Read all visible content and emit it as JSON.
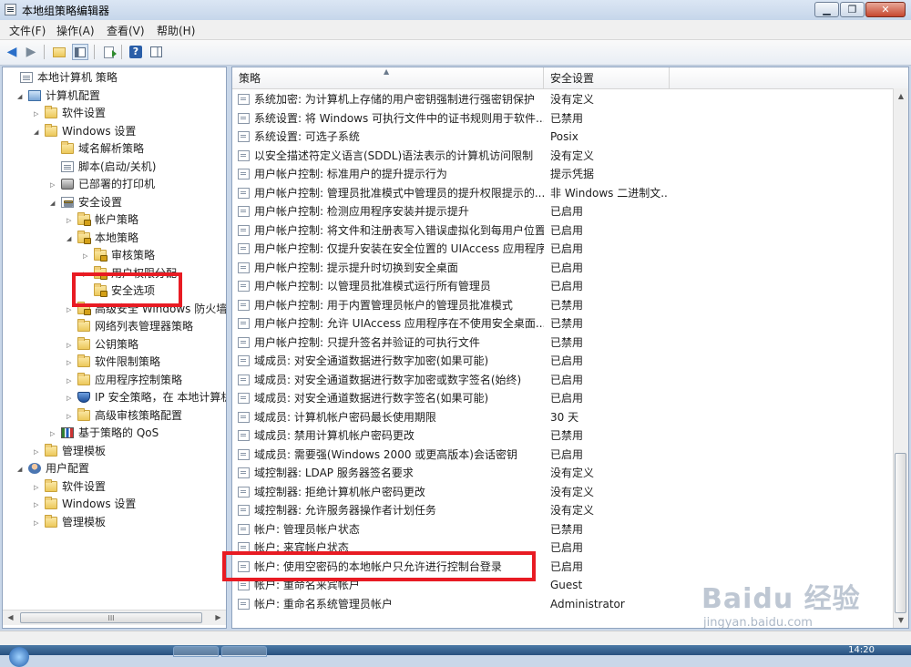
{
  "window": {
    "title": "本地组策略编辑器",
    "buttons": [
      "▁",
      "❐",
      "✕"
    ]
  },
  "menubar": [
    "文件(F)",
    "操作(A)",
    "查看(V)",
    "帮助(H)"
  ],
  "tree": [
    {
      "label": "本地计算机 策略",
      "indent": 0,
      "toggle": "",
      "icon": "doc"
    },
    {
      "label": "计算机配置",
      "indent": 1,
      "toggle": "◢",
      "icon": "comp"
    },
    {
      "label": "软件设置",
      "indent": 2,
      "toggle": "▷",
      "icon": "folder"
    },
    {
      "label": "Windows 设置",
      "indent": 2,
      "toggle": "◢",
      "icon": "folder"
    },
    {
      "label": "域名解析策略",
      "indent": 3,
      "toggle": "",
      "icon": "folder"
    },
    {
      "label": "脚本(启动/关机)",
      "indent": 3,
      "toggle": "",
      "icon": "doc"
    },
    {
      "label": "已部署的打印机",
      "indent": 3,
      "toggle": "▷",
      "icon": "printer"
    },
    {
      "label": "安全设置",
      "indent": 3,
      "toggle": "◢",
      "icon": "lock"
    },
    {
      "label": "帐户策略",
      "indent": 4,
      "toggle": "▷",
      "icon": "folderlock"
    },
    {
      "label": "本地策略",
      "indent": 4,
      "toggle": "◢",
      "icon": "folderlock"
    },
    {
      "label": "审核策略",
      "indent": 5,
      "toggle": "▷",
      "icon": "folderlock"
    },
    {
      "label": "用户权限分配",
      "indent": 5,
      "toggle": "▷",
      "icon": "folderlock"
    },
    {
      "label": "安全选项",
      "indent": 5,
      "toggle": "",
      "icon": "folderlock"
    },
    {
      "label": "高级安全 Windows 防火墙",
      "indent": 4,
      "toggle": "▷",
      "icon": "folderlock"
    },
    {
      "label": "网络列表管理器策略",
      "indent": 4,
      "toggle": "",
      "icon": "folder"
    },
    {
      "label": "公钥策略",
      "indent": 4,
      "toggle": "▷",
      "icon": "folder"
    },
    {
      "label": "软件限制策略",
      "indent": 4,
      "toggle": "▷",
      "icon": "folder"
    },
    {
      "label": "应用程序控制策略",
      "indent": 4,
      "toggle": "▷",
      "icon": "folder"
    },
    {
      "label": "IP 安全策略，在 本地计算机",
      "indent": 4,
      "toggle": "▷",
      "icon": "shield"
    },
    {
      "label": "高级审核策略配置",
      "indent": 4,
      "toggle": "▷",
      "icon": "folder"
    },
    {
      "label": "基于策略的 QoS",
      "indent": 3,
      "toggle": "▷",
      "icon": "chart"
    },
    {
      "label": "管理模板",
      "indent": 2,
      "toggle": "▷",
      "icon": "folder"
    },
    {
      "label": "用户配置",
      "indent": 1,
      "toggle": "◢",
      "icon": "user"
    },
    {
      "label": "软件设置",
      "indent": 2,
      "toggle": "▷",
      "icon": "folder"
    },
    {
      "label": "Windows 设置",
      "indent": 2,
      "toggle": "▷",
      "icon": "folder"
    },
    {
      "label": "管理模板",
      "indent": 2,
      "toggle": "▷",
      "icon": "folder"
    }
  ],
  "left_scroll": {
    "left": "◀",
    "right": "▶",
    "grip": "III"
  },
  "columns": {
    "policy": "策略",
    "setting": "安全设置",
    "sort": "▲"
  },
  "policies": [
    {
      "name": "系统加密: 为计算机上存储的用户密钥强制进行强密钥保护",
      "setting": "没有定义"
    },
    {
      "name": "系统设置: 将 Windows 可执行文件中的证书规则用于软件...",
      "setting": "已禁用"
    },
    {
      "name": "系统设置: 可选子系统",
      "setting": "Posix"
    },
    {
      "name": "以安全描述符定义语言(SDDL)语法表示的计算机访问限制",
      "setting": "没有定义"
    },
    {
      "name": "用户帐户控制: 标准用户的提升提示行为",
      "setting": "提示凭据"
    },
    {
      "name": "用户帐户控制: 管理员批准模式中管理员的提升权限提示的...",
      "setting": "非 Windows 二进制文..."
    },
    {
      "name": "用户帐户控制: 检测应用程序安装并提示提升",
      "setting": "已启用"
    },
    {
      "name": "用户帐户控制: 将文件和注册表写入错误虚拟化到每用户位置",
      "setting": "已启用"
    },
    {
      "name": "用户帐户控制: 仅提升安装在安全位置的 UIAccess 应用程序",
      "setting": "已启用"
    },
    {
      "name": "用户帐户控制: 提示提升时切换到安全桌面",
      "setting": "已启用"
    },
    {
      "name": "用户帐户控制: 以管理员批准模式运行所有管理员",
      "setting": "已启用"
    },
    {
      "name": "用户帐户控制: 用于内置管理员帐户的管理员批准模式",
      "setting": "已禁用"
    },
    {
      "name": "用户帐户控制: 允许 UIAccess 应用程序在不使用安全桌面...",
      "setting": "已禁用"
    },
    {
      "name": "用户帐户控制: 只提升签名并验证的可执行文件",
      "setting": "已禁用"
    },
    {
      "name": "域成员: 对安全通道数据进行数字加密(如果可能)",
      "setting": "已启用"
    },
    {
      "name": "域成员: 对安全通道数据进行数字加密或数字签名(始终)",
      "setting": "已启用"
    },
    {
      "name": "域成员: 对安全通道数据进行数字签名(如果可能)",
      "setting": "已启用"
    },
    {
      "name": "域成员: 计算机帐户密码最长使用期限",
      "setting": "30 天"
    },
    {
      "name": "域成员: 禁用计算机帐户密码更改",
      "setting": "已禁用"
    },
    {
      "name": "域成员: 需要强(Windows 2000 或更高版本)会话密钥",
      "setting": "已启用"
    },
    {
      "name": "域控制器: LDAP 服务器签名要求",
      "setting": "没有定义"
    },
    {
      "name": "域控制器: 拒绝计算机帐户密码更改",
      "setting": "没有定义"
    },
    {
      "name": "域控制器: 允许服务器操作者计划任务",
      "setting": "没有定义"
    },
    {
      "name": "帐户: 管理员帐户状态",
      "setting": "已禁用"
    },
    {
      "name": "帐户: 来宾帐户状态",
      "setting": "已启用"
    },
    {
      "name": "帐户: 使用空密码的本地帐户只允许进行控制台登录",
      "setting": "已启用"
    },
    {
      "name": "帐户: 重命名来宾帐户",
      "setting": "Guest"
    },
    {
      "name": "帐户: 重命名系统管理员帐户",
      "setting": "Administrator"
    }
  ],
  "vscroll": {
    "up": "▲",
    "down": "▼"
  },
  "watermark": {
    "logo": "Baidu 经验",
    "sub": "jingyan.baidu.com"
  },
  "taskbar": {
    "clock": "14:20"
  },
  "colors": {
    "highlight": "#e81b23",
    "accent": "#3d6ea5"
  }
}
